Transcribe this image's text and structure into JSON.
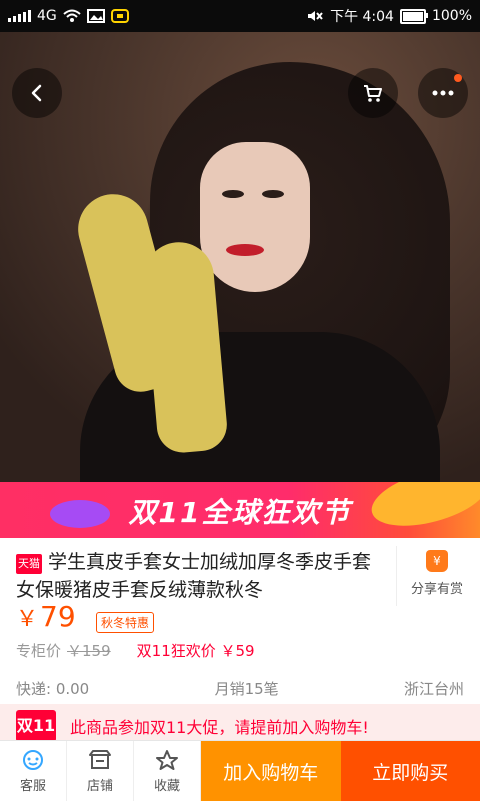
{
  "status_bar": {
    "network": "4G",
    "time": "下午 4:04",
    "battery": "100%"
  },
  "product": {
    "badge": "天猫",
    "title": "学生真皮手套女士加绒加厚冬季皮手套女保暖猪皮手套反绒薄款秋冬",
    "price_symbol": "￥",
    "price": "79",
    "promo_tag": "秋冬特惠",
    "counter_price_label": "专柜价",
    "counter_price": "￥159",
    "double11_price": "双11狂欢价 ￥59",
    "shipping": "快递: 0.00",
    "monthly_sales": "月销15笔",
    "location": "浙江台州"
  },
  "share": {
    "label": "分享有赏",
    "icon": "money-bag-icon"
  },
  "banner": {
    "text": "双11全球狂欢节"
  },
  "notice": {
    "logo": "双11",
    "text": "此商品参加双11大促，请提前加入购物车!"
  },
  "carousel": {
    "total": 5,
    "active_index": 0
  },
  "bottom": {
    "customer_service": "客服",
    "shop": "店铺",
    "favorite": "收藏",
    "add_to_cart": "加入购物车",
    "buy_now": "立即购买"
  },
  "colors": {
    "primary": "#ff5000",
    "secondary": "#ff9200",
    "tmall_red": "#ff0036"
  }
}
